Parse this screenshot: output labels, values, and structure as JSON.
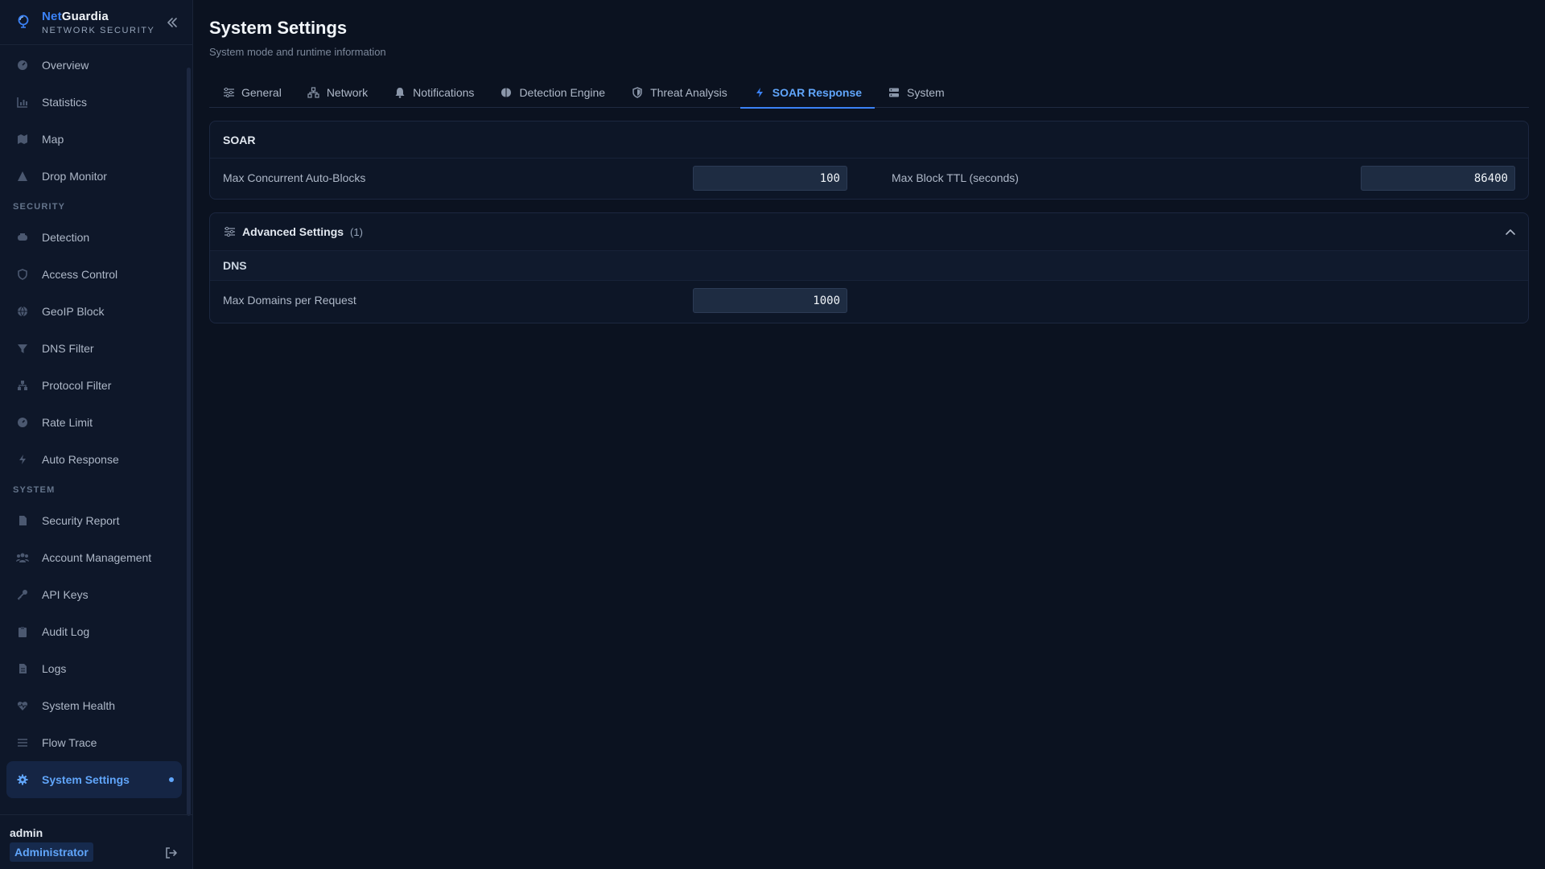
{
  "brand": {
    "name_accent": "Net",
    "name_rest": "Guardia",
    "subtitle": "NETWORK SECURITY"
  },
  "sidebar": {
    "main_items": [
      {
        "label": "Overview",
        "icon": "gauge-icon"
      },
      {
        "label": "Statistics",
        "icon": "bar-chart-icon"
      },
      {
        "label": "Map",
        "icon": "map-icon"
      },
      {
        "label": "Drop Monitor",
        "icon": "warning-triangle-icon"
      }
    ],
    "security_label": "SECURITY",
    "security_items": [
      {
        "label": "Detection",
        "icon": "detection-icon"
      },
      {
        "label": "Access Control",
        "icon": "shield-icon"
      },
      {
        "label": "GeoIP Block",
        "icon": "globe-icon"
      },
      {
        "label": "DNS Filter",
        "icon": "filter-icon"
      },
      {
        "label": "Protocol Filter",
        "icon": "network-icon"
      },
      {
        "label": "Rate Limit",
        "icon": "gauge-icon"
      },
      {
        "label": "Auto Response",
        "icon": "lightning-icon"
      }
    ],
    "system_label": "SYSTEM",
    "system_items": [
      {
        "label": "Security Report",
        "icon": "document-icon"
      },
      {
        "label": "Account Management",
        "icon": "users-icon"
      },
      {
        "label": "API Keys",
        "icon": "key-icon"
      },
      {
        "label": "Audit Log",
        "icon": "clipboard-icon"
      },
      {
        "label": "Logs",
        "icon": "file-icon"
      },
      {
        "label": "System Health",
        "icon": "heart-pulse-icon"
      },
      {
        "label": "Flow Trace",
        "icon": "list-icon"
      },
      {
        "label": "System Settings",
        "icon": "gear-icon",
        "active": true
      }
    ]
  },
  "user": {
    "name": "admin",
    "role": "Administrator"
  },
  "page": {
    "title": "System Settings",
    "subtitle": "System mode and runtime information"
  },
  "tabs": [
    {
      "label": "General",
      "icon": "sliders-icon"
    },
    {
      "label": "Network",
      "icon": "network-icon"
    },
    {
      "label": "Notifications",
      "icon": "bell-icon"
    },
    {
      "label": "Detection Engine",
      "icon": "brain-icon"
    },
    {
      "label": "Threat Analysis",
      "icon": "shield-icon"
    },
    {
      "label": "SOAR Response",
      "icon": "lightning-icon",
      "active": true
    },
    {
      "label": "System",
      "icon": "server-icon"
    }
  ],
  "soar": {
    "title": "SOAR",
    "max_concurrent_label": "Max Concurrent Auto-Blocks",
    "max_concurrent_value": "100",
    "max_ttl_label": "Max Block TTL (seconds)",
    "max_ttl_value": "86400"
  },
  "advanced": {
    "title": "Advanced Settings",
    "count": "(1)",
    "group_title": "DNS",
    "max_domains_label": "Max Domains per Request",
    "max_domains_value": "1000"
  },
  "colors": {
    "accent": "#3b82f6",
    "background": "#0b1220",
    "sidebar": "#0e1729"
  }
}
